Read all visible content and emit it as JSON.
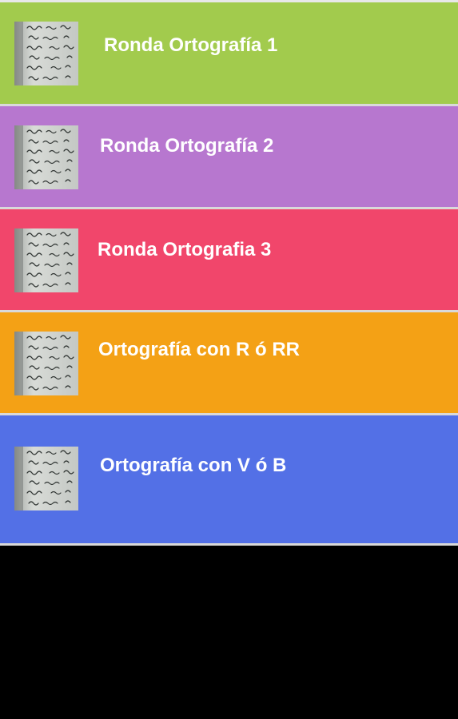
{
  "menu": {
    "items": [
      {
        "label": "Ronda Ortografía 1",
        "color": "#a2cb4d",
        "icon": "handwritten-notebook-icon"
      },
      {
        "label": "Ronda Ortografía 2",
        "color": "#b777cf",
        "icon": "handwritten-notebook-icon"
      },
      {
        "label": "Ronda Ortografia 3",
        "color": "#f1466b",
        "icon": "handwritten-notebook-icon"
      },
      {
        "label": "Ortografía con R ó RR",
        "color": "#f4a115",
        "icon": "handwritten-notebook-icon"
      },
      {
        "label": "Ortografía con V ó B",
        "color": "#5370e6",
        "icon": "handwritten-notebook-icon"
      }
    ]
  }
}
